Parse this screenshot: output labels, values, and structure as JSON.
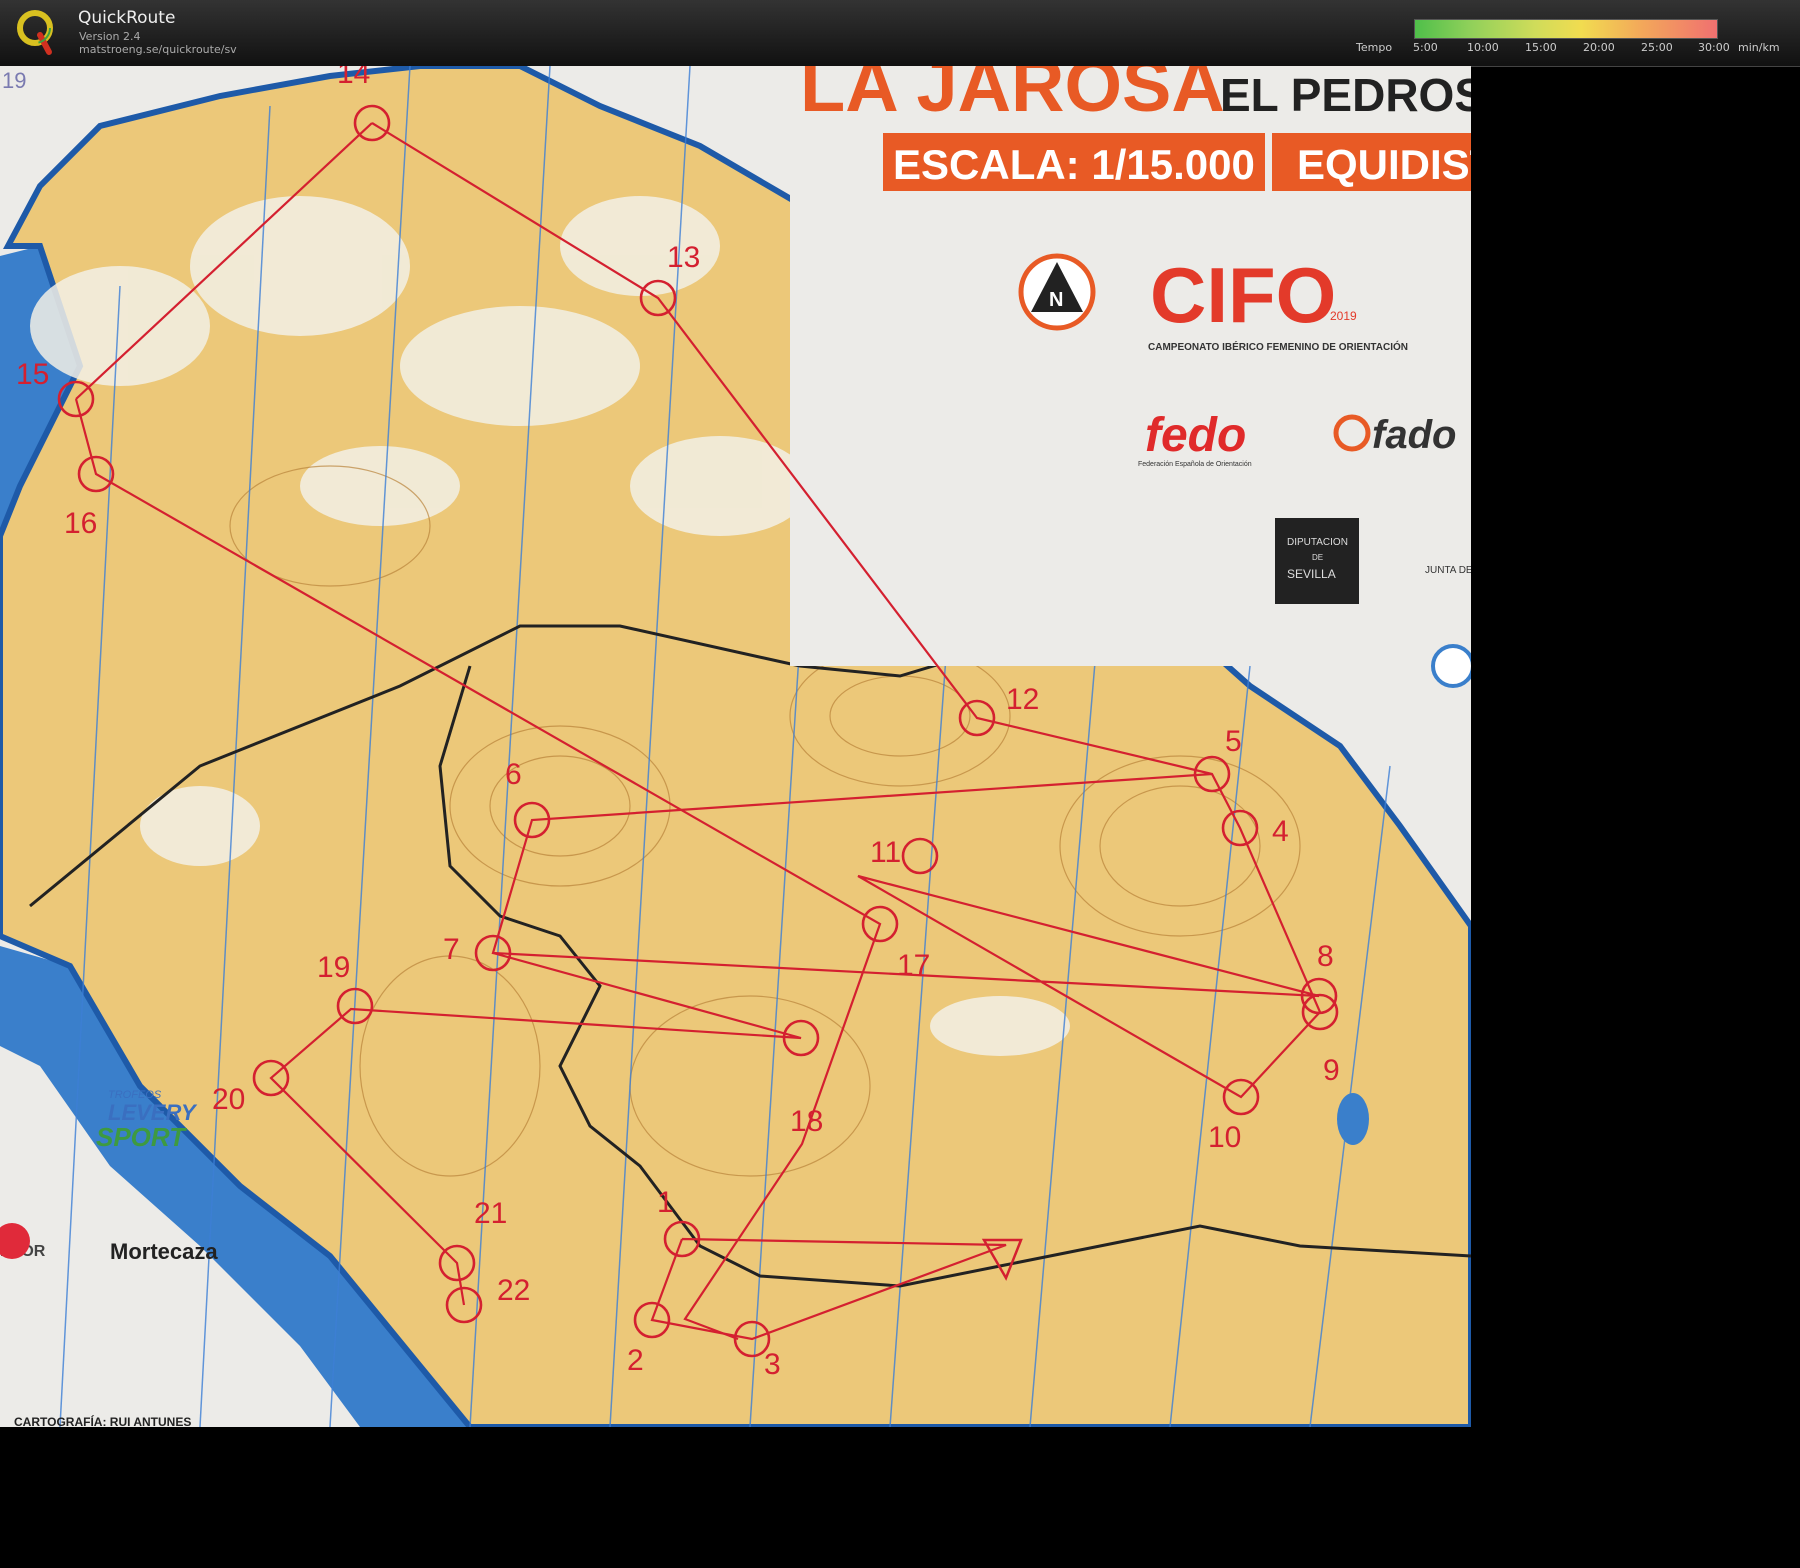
{
  "app": {
    "title": "QuickRoute",
    "version": "Version 2.4",
    "url": "matstroeng.se/quickroute/sv"
  },
  "tempo": {
    "label": "Tempo",
    "ticks": [
      "5:00",
      "10:00",
      "15:00",
      "20:00",
      "25:00",
      "30:00"
    ],
    "unit": "min/km"
  },
  "map": {
    "title_left": "LA JAROSA",
    "title_right": "EL PEDROSO",
    "scale": "ESCALA: 1/15.000",
    "equidist": "EQUIDIST",
    "corner_number": "19",
    "cifo_text": "CIFO",
    "cifo_year": "2019",
    "cifo_caption": "CAMPEONATO IBÉRICO FEMENINO DE ORIENTACIÓN",
    "fedo": "fedo",
    "fedo_caption": "Federación Española de Orientación",
    "fado": "fado",
    "diputacion_1": "DIPUTACION",
    "diputacion_2": "DE",
    "diputacion_3": "SEVILLA",
    "junta": "JUNTA DE",
    "trofeos": "TROFEOS",
    "levery": "LEVERY",
    "sport": "SPORT",
    "mortecaza": "Mortecaza",
    "rlor": "RLOR",
    "cartografia": "CARTOGRAFÍA: RUI ANTUNES",
    "controls": [
      "14",
      "13",
      "15",
      "16",
      "12",
      "5",
      "4",
      "6",
      "11",
      "8",
      "7",
      "17",
      "19",
      "9",
      "20",
      "18",
      "10",
      "1",
      "21",
      "22",
      "2",
      "3"
    ]
  },
  "colors": {
    "course": "#d42030",
    "map_bg": "#ecc879",
    "lake": "#3a7fcb",
    "title_orange": "#e85a25"
  }
}
